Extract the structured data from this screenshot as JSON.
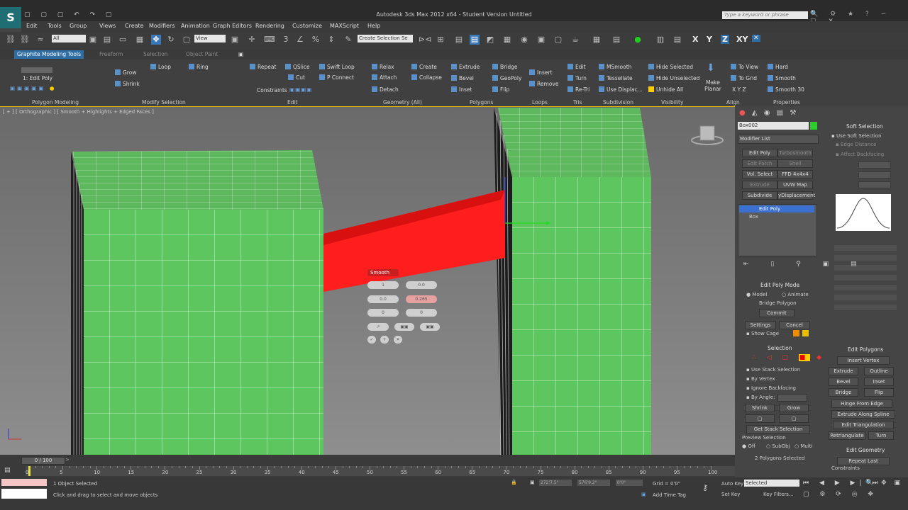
{
  "app": {
    "title": "Autodesk 3ds Max 2012 x64 - Student Version    Untitled",
    "logo": "S",
    "search_placeholder": "Type a keyword or phrase"
  },
  "menu": [
    "Edit",
    "Tools",
    "Group",
    "Views",
    "Create",
    "Modifiers",
    "Animation",
    "Graph Editors",
    "Rendering",
    "Customize",
    "MAXScript",
    "Help"
  ],
  "toolbar": {
    "filter": "All",
    "ref_coord": "View",
    "named_sel": "Create Selection Se",
    "axes": [
      "X",
      "Y",
      "Z",
      "XY"
    ]
  },
  "ribbon": {
    "tabs": [
      "Graphite Modeling Tools",
      "Freeform",
      "Selection",
      "Object Paint"
    ],
    "sub_label": "1: Edit Poly",
    "polygon_modeling": "Polygon Modeling",
    "modify_selection": {
      "label": "Modify Selection",
      "grow": "Grow",
      "shrink": "Shrink",
      "loop": "Loop",
      "ring": "Ring"
    },
    "edit": {
      "label": "Edit",
      "repeat": "Repeat",
      "qslice": "QSlice",
      "swift_loop": "Swift Loop",
      "cut": "Cut",
      "p_connect": "P Connect",
      "constraints": "Constraints"
    },
    "geometry": {
      "label": "Geometry (All)",
      "relax": "Relax",
      "create": "Create",
      "attach": "Attach",
      "collapse": "Collapse",
      "detach": "Detach"
    },
    "polygons": {
      "label": "Polygons",
      "extrude": "Extrude",
      "bridge": "Bridge",
      "bevel": "Bevel",
      "geopoly": "GeoPoly",
      "inset": "Inset",
      "flip": "Flip"
    },
    "loops": {
      "label": "Loops",
      "insert": "Insert",
      "remove": "Remove"
    },
    "tris": {
      "label": "Tris",
      "edit": "Edit",
      "turn": "Turn",
      "retri": "Re-Tri"
    },
    "subdivision": {
      "label": "Subdivision",
      "msmooth": "MSmooth",
      "tessellate": "Tessellate",
      "use_displac": "Use Displac..."
    },
    "visibility": {
      "label": "Visibility",
      "hide_selected": "Hide Selected",
      "hide_unselected": "Hide Unselected",
      "unhide_all": "Unhide All"
    },
    "align": {
      "label": "Align",
      "make_planar": "Make Planar",
      "to_view": "To View",
      "to_grid": "To Grid",
      "xyz": "X  Y  Z"
    },
    "properties": {
      "label": "Properties",
      "hard": "Hard",
      "smooth": "Smooth",
      "smooth30": "Smooth 30"
    }
  },
  "viewport": {
    "label": "[ + ] [ Orthographic ] [ Smooth + Highlights + Edged Faces ]",
    "caddy_title": "Smooth",
    "caddy_values": [
      "1",
      "0.0",
      "0.0",
      "0.265",
      "0",
      "0"
    ]
  },
  "command_panel": {
    "object_name": "Box002",
    "modifier_list": "Modifier List",
    "mod_buttons": [
      "Edit Poly",
      "Turbosmooth",
      "Edit Patch",
      "Shell",
      "Vol. Select",
      "FFD 4x4x4",
      "Extrude",
      "UVW Map",
      "Subdivide",
      "yDisplacement"
    ],
    "stack": [
      "Edit Poly",
      "Box"
    ],
    "edit_poly_mode": {
      "title": "Edit Poly Mode",
      "model": "Model",
      "animate": "Animate",
      "op": "Bridge Polygon",
      "commit": "Commit",
      "settings": "Settings",
      "cancel": "Cancel",
      "show_cage": "Show Cage"
    },
    "selection": {
      "title": "Selection",
      "use_stack": "Use Stack Selection",
      "by_vertex": "By Vertex",
      "ignore_backfacing": "Ignore Backfacing",
      "by_angle": "By Angle:",
      "shrink": "Shrink",
      "grow": "Grow",
      "get_stack": "Get Stack Selection",
      "preview": "Preview Selection",
      "off": "Off",
      "subobj": "SubObj",
      "multi": "Multi",
      "status": "2 Polygons Selected"
    },
    "soft_selection": {
      "title": "Soft Selection",
      "use_soft": "Use Soft Selection",
      "edge_distance": "Edge Distance",
      "affect_backfacing": "Affect Backfacing"
    },
    "edit_polygons": {
      "title": "Edit Polygons",
      "insert_vertex": "Insert Vertex",
      "extrude": "Extrude",
      "outline": "Outline",
      "bevel": "Bevel",
      "inset": "Inset",
      "bridge": "Bridge",
      "flip": "Flip",
      "hinge": "Hinge From Edge",
      "extrude_spline": "Extrude Along Spline",
      "edit_tri": "Edit Triangulation",
      "retriangulate": "Retriangulate",
      "turn": "Turn"
    },
    "edit_geometry": {
      "title": "Edit Geometry",
      "repeat_last": "Repeat Last",
      "constraints": "Constraints"
    }
  },
  "timeline": {
    "frame": "0 / 100",
    "ticks": [
      "0",
      "5",
      "10",
      "15",
      "20",
      "25",
      "30",
      "35",
      "40",
      "45",
      "50",
      "55",
      "60",
      "65",
      "70",
      "75",
      "80",
      "85",
      "90",
      "95",
      "100"
    ],
    "current": 0,
    "total": 100
  },
  "status": {
    "selected": "1 Object Selected",
    "prompt": "Click and drag to select and move objects",
    "grid": "Grid = 0'0\"",
    "auto_key": "Auto Key",
    "set_key": "Set Key",
    "selected_dd": "Selected",
    "add_time_tag": "Add Time Tag",
    "key_filters": "Key Filters...",
    "x_value": "272'7.5\"",
    "y_value": "576'9.2\"",
    "z_value": "0'0\""
  }
}
